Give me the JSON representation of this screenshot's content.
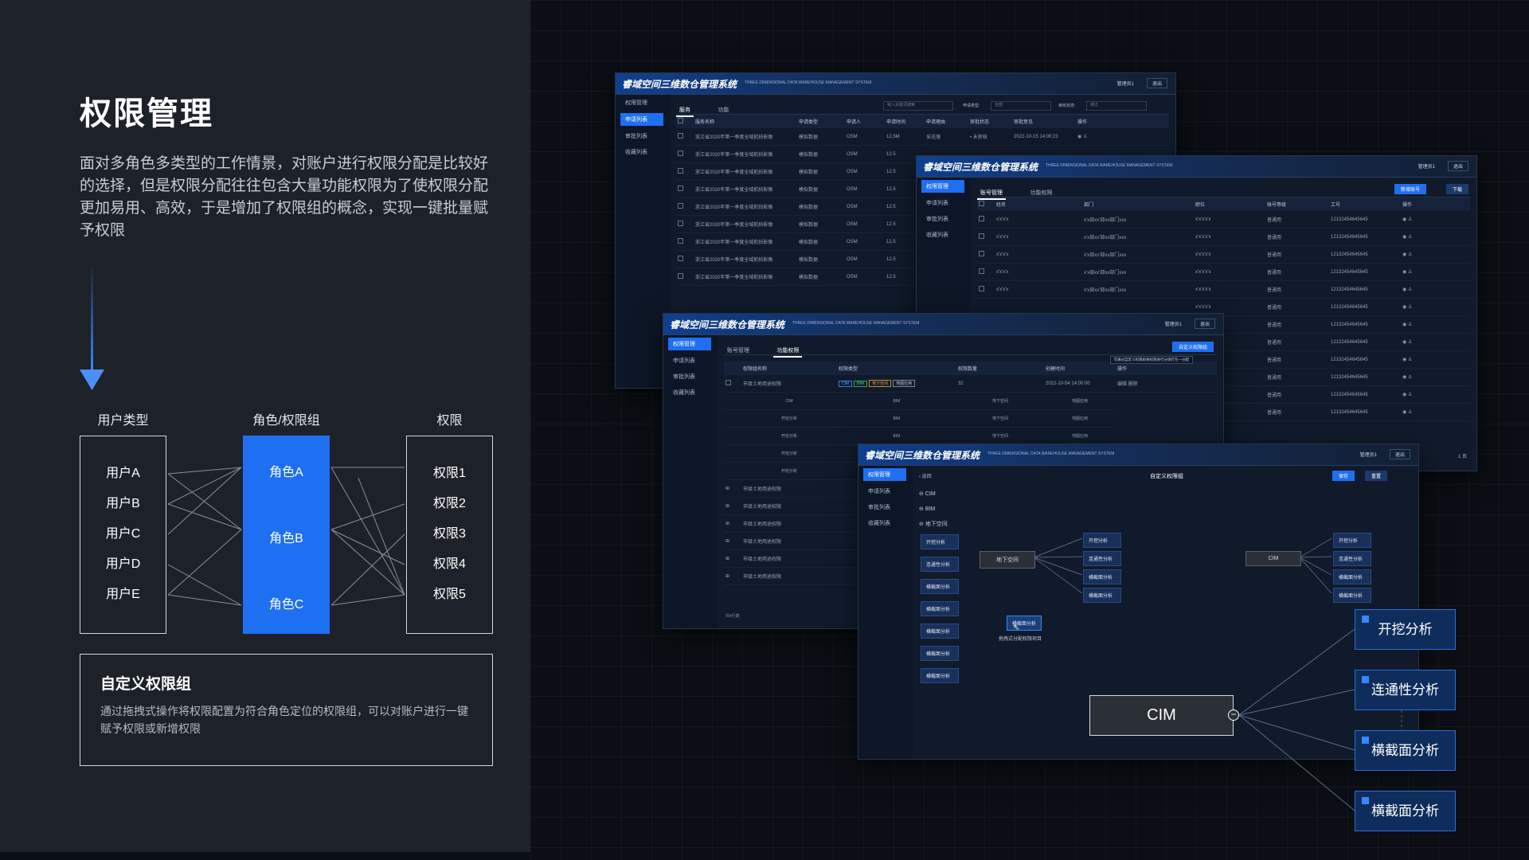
{
  "page": {
    "title": "权限管理",
    "description": "面对多角色多类型的工作情景，对账户进行权限分配是比较好的选择，但是权限分配往往包含大量功能权限为了使权限分配更加易用、高效，于是增加了权限组的概念，实现一键批量赋予权限"
  },
  "diagram": {
    "headers": {
      "users": "用户类型",
      "roles": "角色/权限组",
      "perms": "权限"
    },
    "users": [
      "用户A",
      "用户B",
      "用户C",
      "用户D",
      "用户E"
    ],
    "roles": [
      "角色A",
      "角色B",
      "角色C"
    ],
    "perms": [
      "权限1",
      "权限2",
      "权限3",
      "权限4",
      "权限5"
    ],
    "accent": "#1f6ff2"
  },
  "custom_group": {
    "title": "自定义权限组",
    "desc": "通过拖拽式操作将权限配置为符合角色定位的权限组，可以对账户进行一键赋予权限或新增权限"
  },
  "system": {
    "logo": "睿域空间三维数仓管理系统",
    "subtitle": "THREE DIMENSIONAL DATA WAREHOUSE MANAGEMENT SYSTEM",
    "user": "管理员1",
    "exit": "退出",
    "sidebar": [
      "权限管理",
      "申请列表",
      "审批列表",
      "收藏列表"
    ]
  },
  "win1": {
    "tabs": [
      "服务",
      "功能"
    ],
    "search_placeholder": "输入关键词搜索",
    "filter1_label": "申请类型:",
    "filter1_value": "全部",
    "filter2_label": "审核状态:",
    "filter2_value": "通过",
    "columns": [
      "服务名称",
      "申请类型",
      "申请人",
      "申请时间",
      "申请理由",
      "审批状态",
      "审批意见",
      "操作"
    ],
    "rows": [
      [
        "浙江省2020年第一季度全域航拍影像",
        "模拟数据",
        "OSM",
        "12.5M",
        "采花落",
        "• 未审核",
        "2022-10-15 14:00:23"
      ],
      [
        "浙江省2020年第一季度全域航拍影像",
        "模拟数据",
        "OSM",
        "12.5",
        "",
        "",
        ""
      ],
      [
        "浙江省2020年第一季度全域航拍影像",
        "模拟数据",
        "OSM",
        "12.5",
        "",
        "",
        ""
      ],
      [
        "浙江省2020年第一季度全域航拍影像",
        "模拟数据",
        "OSM",
        "12.5",
        "",
        "",
        ""
      ],
      [
        "浙江省2020年第一季度全域航拍影像",
        "模拟数据",
        "OSM",
        "12.5",
        "",
        "",
        ""
      ],
      [
        "浙江省2020年第一季度全域航拍影像",
        "模拟数据",
        "OSM",
        "12.5",
        "",
        "",
        ""
      ],
      [
        "浙江省2020年第一季度全域航拍影像",
        "模拟数据",
        "OSM",
        "12.5",
        "",
        "",
        ""
      ],
      [
        "浙江省2020年第一季度全域航拍影像",
        "模拟数据",
        "OSM",
        "12.5",
        "",
        "",
        ""
      ],
      [
        "浙江省2020年第一季度全域航拍影像",
        "模拟数据",
        "OSM",
        "12.5",
        "",
        "",
        ""
      ]
    ]
  },
  "win2": {
    "tabs": [
      "账号管理",
      "功能权限"
    ],
    "add_btn": "新增账号",
    "download_btn": "下载",
    "columns": [
      "姓名",
      "部门",
      "职位",
      "账号等级",
      "工号",
      "操作"
    ],
    "rows": [
      [
        "x'x'x'x",
        "x'x部xx'部xx部门xxx",
        "x'x'x'x'x",
        "普通用",
        "12132454645645"
      ],
      [
        "x'x'x'x",
        "x'x部xx'部xx部门xxx",
        "x'x'x'x'x",
        "普通用",
        "12132454645645"
      ],
      [
        "x'x'x'x",
        "x'x部xx'部xx部门xxx",
        "x'x'x'x'x",
        "普通用",
        "12132454645645"
      ],
      [
        "x'x'x'x",
        "x'x部xx'部xx部门xxx",
        "x'x'x'x'x",
        "普通用",
        "12132454645645"
      ],
      [
        "x'x'x'x",
        "x'x部xx'部xx部门xxx",
        "x'x'x'x'x",
        "普通用",
        "12132454645645"
      ],
      [
        "",
        "",
        "x'x'x'x'x",
        "普通用",
        "12132454645645"
      ],
      [
        "",
        "",
        "x'x'x'x'x",
        "普通用",
        "12132454645645"
      ],
      [
        "",
        "",
        "x'x'x'x'x",
        "普通用",
        "12132454645645"
      ],
      [
        "",
        "",
        "x'x'x'x'x",
        "普通用",
        "12132454645645"
      ],
      [
        "",
        "",
        "x'x'x'x'x",
        "普通用",
        "12132454645645"
      ],
      [
        "",
        "",
        "x'x'x'x'x",
        "普通用",
        "12132454645645"
      ],
      [
        "",
        "",
        "x'x'x'x'x",
        "普通用",
        "12132454645645"
      ]
    ],
    "pager": "1 页"
  },
  "win3": {
    "tabs": [
      "账号管理",
      "功能权限"
    ],
    "add_btn": "自定义权限组",
    "tooltip": "可通过自定义权限组将权限进行分组打包一分配",
    "columns": [
      "权限组名称",
      "权限类型",
      "权限数量",
      "创建时间",
      "操作"
    ],
    "first_row": {
      "name": "市级土地用途权限",
      "tags": [
        "CIM",
        "BIM",
        "地下空间",
        "地图应用"
      ],
      "count": "32",
      "time": "2022-10-54 14:00:00",
      "ops": "编辑 删除"
    },
    "sub_rows": [
      [
        "CIM",
        "BIM",
        "地下空间",
        "地图应用"
      ],
      [
        "开挖分析",
        "BIM",
        "地下空间",
        "地图应用"
      ],
      [
        "开挖分析",
        "BIM",
        "地下空间",
        "地图应用"
      ],
      [
        "开挖分析",
        "BIM",
        "地下空间",
        "地图应用"
      ],
      [
        "开挖分析",
        "",
        "",
        ""
      ]
    ],
    "group_rows": [
      "市级土地用途权限",
      "市级土地用途权限",
      "市级土地用途权限",
      "市级土地用途权限",
      "市级土地用途权限",
      "市级土地用途权限"
    ],
    "footer": "共4行数"
  },
  "win4": {
    "back": "返回",
    "title": "自定义权限组",
    "save_btn": "保存",
    "reset_btn": "重置",
    "tree": [
      "CIM",
      "BIM",
      "地下空间"
    ],
    "palette": [
      "开挖分析",
      "连通性分析",
      "横截面分析",
      "横截面分析",
      "横截面分析",
      "横截面分析",
      "横截面分析"
    ],
    "mid_node": "地下空间",
    "mid_children": [
      "开挖分析",
      "连通性分析",
      "横截面分析",
      "横截面分析"
    ],
    "cim_node": "CIM",
    "cim_children": [
      "开挖分析",
      "连通性分析",
      "横截面分析",
      "横截面分析"
    ],
    "drag_node": "横截面分析",
    "drag_hint": "拖拽式分配权限项目"
  },
  "overlay": {
    "cim": "CIM",
    "nodes": [
      "开挖分析",
      "连通性分析",
      "横截面分析",
      "横截面分析"
    ],
    "accent": "#1f6ff2"
  }
}
